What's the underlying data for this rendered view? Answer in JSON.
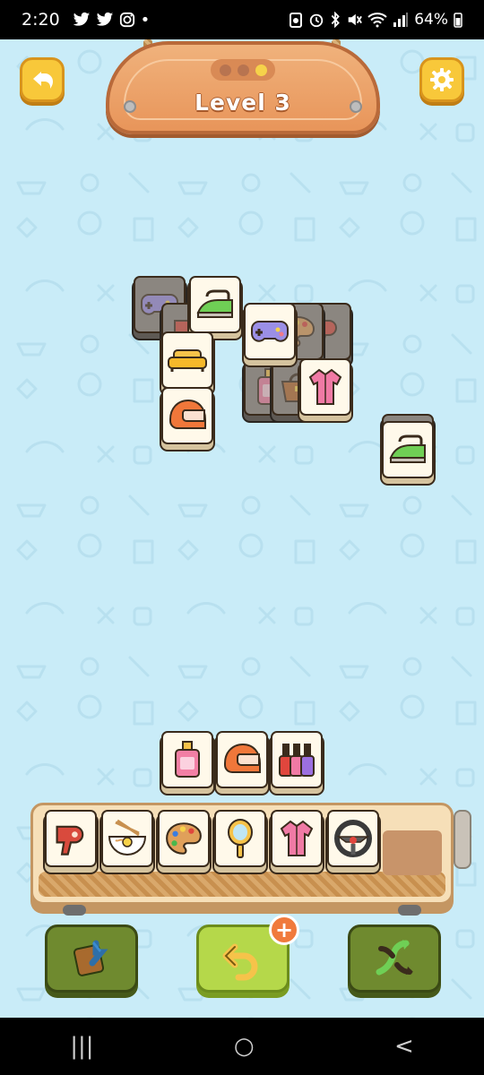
{
  "status_bar": {
    "time": "2:20",
    "battery": "64%",
    "left_icons": [
      "twitter-icon",
      "twitter-icon",
      "instagram-icon",
      "dot-icon"
    ],
    "right_icons": [
      "battery-saver-icon",
      "alarm-icon",
      "bluetooth-icon",
      "mute-icon",
      "wifi-icon",
      "signal-icon"
    ]
  },
  "header": {
    "level_title": "Level 3",
    "progress_dots": 3,
    "progress_current": 3,
    "back_icon": "back-arrow-icon",
    "settings_icon": "gear-icon"
  },
  "board": {
    "tiles": [
      {
        "item": "gamepad",
        "state": "blocked"
      },
      {
        "item": "hair-dryer",
        "state": "blocked"
      },
      {
        "item": "iron",
        "state": "free"
      },
      {
        "item": "palette",
        "state": "blocked"
      },
      {
        "item": "hair-dryer",
        "state": "blocked"
      },
      {
        "item": "gamepad",
        "state": "free"
      },
      {
        "item": "sofa",
        "state": "free"
      },
      {
        "item": "perfume",
        "state": "blocked"
      },
      {
        "item": "handbag",
        "state": "blocked"
      },
      {
        "item": "shirt",
        "state": "free"
      },
      {
        "item": "helmet",
        "state": "free"
      },
      {
        "item": "iron",
        "state": "free"
      }
    ]
  },
  "staging": {
    "tiles": [
      "perfume",
      "helmet",
      "nail-polish"
    ]
  },
  "tray": {
    "capacity": 7,
    "tiles": [
      "hair-dryer",
      "noodle-bowl",
      "palette",
      "hand-mirror",
      "shirt",
      "steering-wheel"
    ]
  },
  "actions": [
    {
      "name": "shuffle-back",
      "icon": "return-tile-icon",
      "style": "dark"
    },
    {
      "name": "undo",
      "icon": "undo-icon",
      "style": "light",
      "badge": "+"
    },
    {
      "name": "shuffle",
      "icon": "shuffle-icon",
      "style": "dark"
    }
  ],
  "nav_bar": {
    "recents": "|||",
    "home": "○",
    "back": "<"
  }
}
